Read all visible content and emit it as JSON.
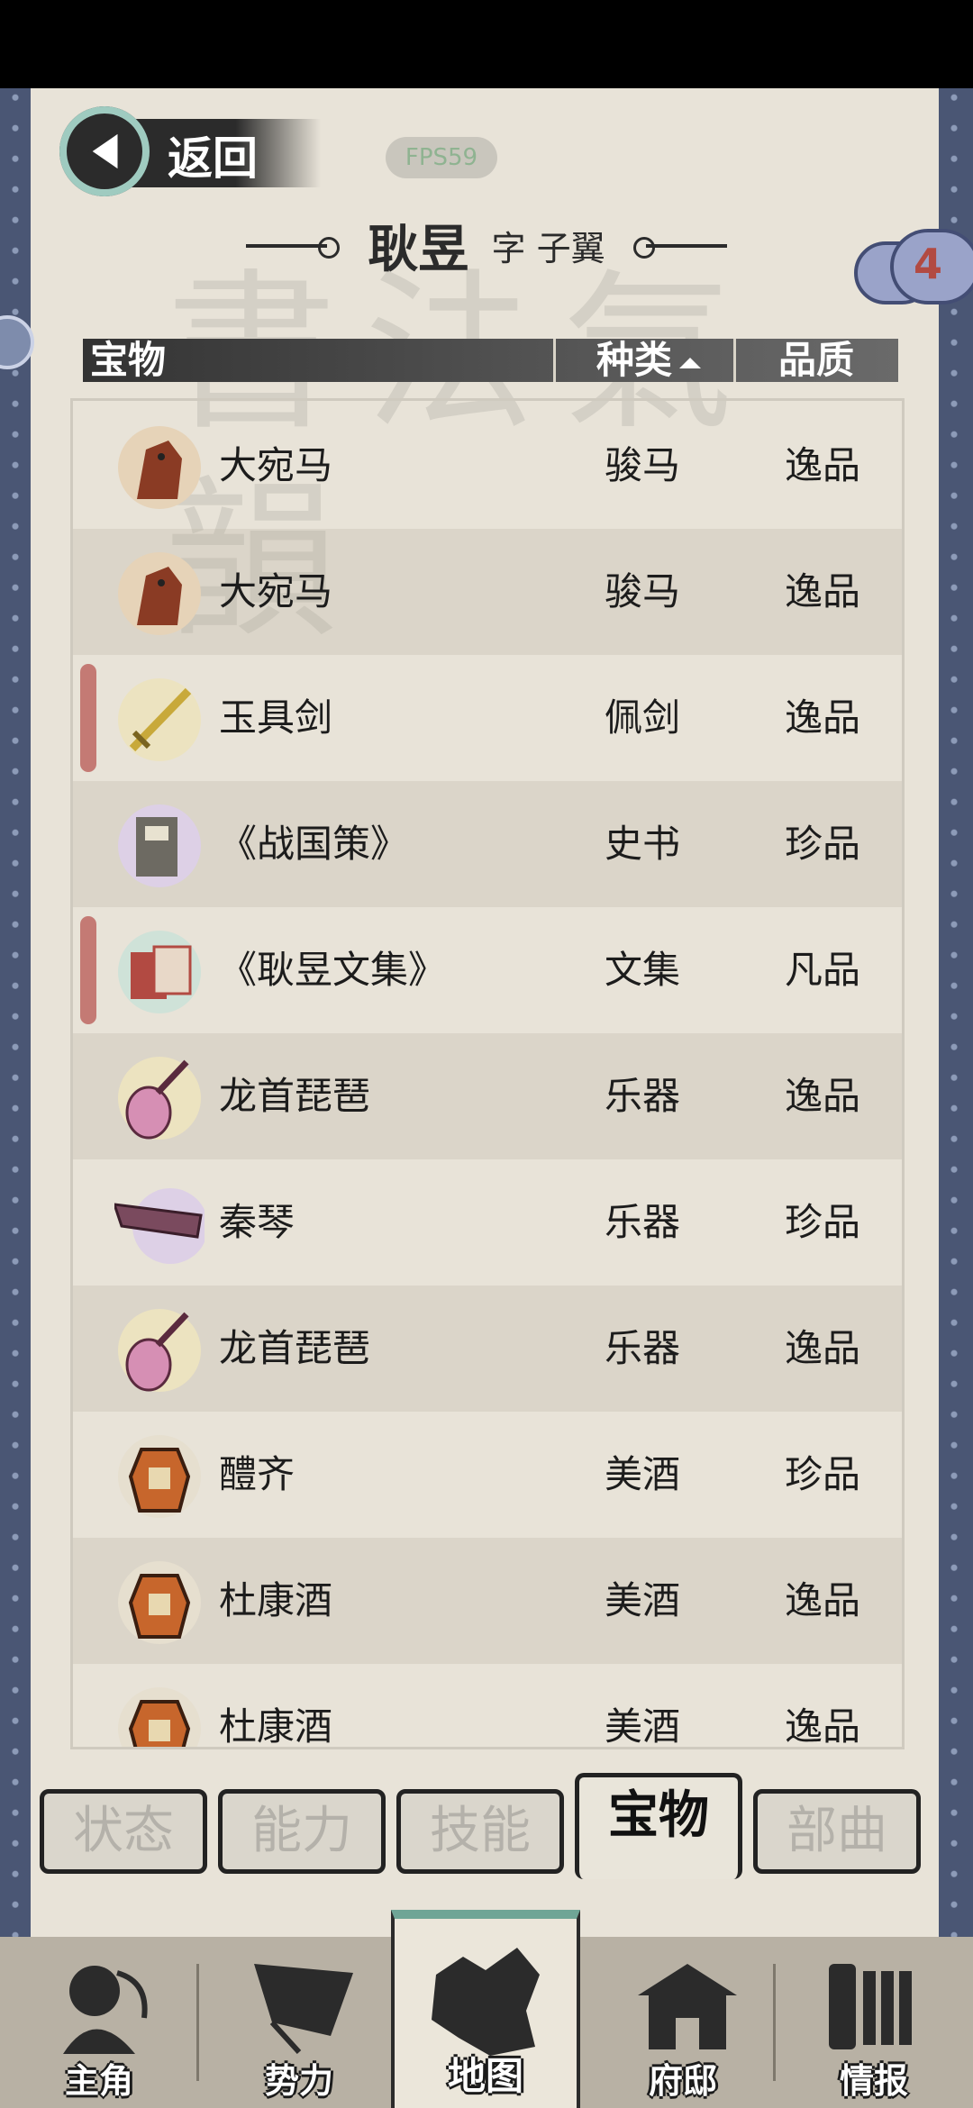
{
  "header": {
    "back_label": "返回",
    "fps": "FPS59",
    "name": "耿昱",
    "courtesy": "字  子翼",
    "badge_count": "4"
  },
  "table": {
    "col_item": "宝物",
    "col_kind": "种类",
    "col_quality": "品质",
    "rows": [
      {
        "name": "大宛马",
        "kind": "骏马",
        "quality": "逸品",
        "icon": "horse-icon"
      },
      {
        "name": "大宛马",
        "kind": "骏马",
        "quality": "逸品",
        "icon": "horse-icon"
      },
      {
        "name": "玉具剑",
        "kind": "佩剑",
        "quality": "逸品",
        "icon": "sword-icon"
      },
      {
        "name": "《战国策》",
        "kind": "史书",
        "quality": "珍品",
        "icon": "book-icon"
      },
      {
        "name": "《耿昱文集》",
        "kind": "文集",
        "quality": "凡品",
        "icon": "scroll-book-icon"
      },
      {
        "name": "龙首琵琶",
        "kind": "乐器",
        "quality": "逸品",
        "icon": "pipa-icon"
      },
      {
        "name": "秦琴",
        "kind": "乐器",
        "quality": "珍品",
        "icon": "qin-icon"
      },
      {
        "name": "龙首琵琶",
        "kind": "乐器",
        "quality": "逸品",
        "icon": "pipa-icon"
      },
      {
        "name": "醴齐",
        "kind": "美酒",
        "quality": "珍品",
        "icon": "wine-jar-icon"
      },
      {
        "name": "杜康酒",
        "kind": "美酒",
        "quality": "逸品",
        "icon": "wine-jar-icon"
      },
      {
        "name": "杜康酒",
        "kind": "美酒",
        "quality": "逸品",
        "icon": "wine-jar-icon"
      }
    ]
  },
  "tabs": [
    {
      "label": "状态",
      "active": false
    },
    {
      "label": "能力",
      "active": false
    },
    {
      "label": "技能",
      "active": false
    },
    {
      "label": "宝物",
      "active": true
    },
    {
      "label": "部曲",
      "active": false
    }
  ],
  "nav": [
    {
      "label": "主角",
      "icon": "hero-icon"
    },
    {
      "label": "势力",
      "icon": "flag-icon"
    },
    {
      "label": "地图",
      "icon": "map-icon"
    },
    {
      "label": "府邸",
      "icon": "mansion-icon"
    },
    {
      "label": "情报",
      "icon": "intel-scroll-icon"
    }
  ]
}
